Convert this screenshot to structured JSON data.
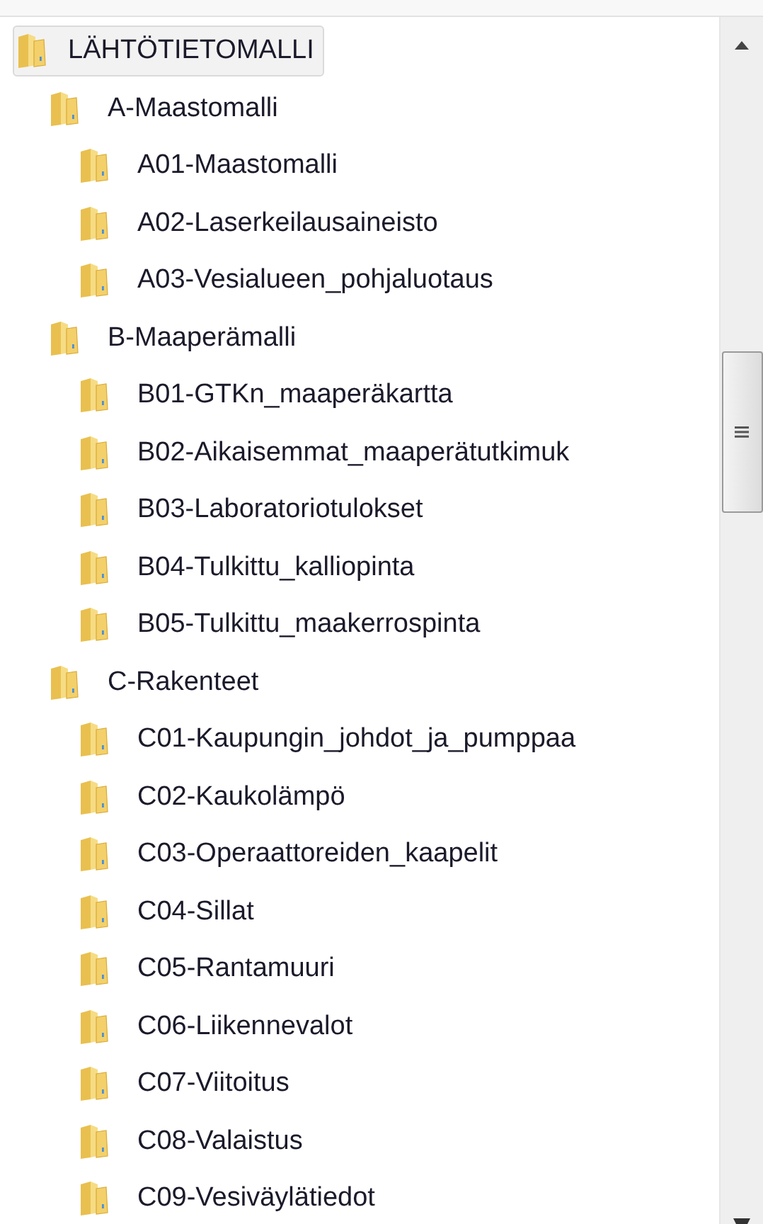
{
  "tree": [
    {
      "label": "LÄHTÖTIETOMALLI",
      "selected": true,
      "children": [
        {
          "label": "A-Maastomalli",
          "selected": false,
          "children": [
            {
              "label": "A01-Maastomalli",
              "selected": false
            },
            {
              "label": "A02-Laserkeilausaineisto",
              "selected": false
            },
            {
              "label": "A03-Vesialueen_pohjaluotaus",
              "selected": false
            }
          ]
        },
        {
          "label": "B-Maaperämalli",
          "selected": false,
          "children": [
            {
              "label": "B01-GTKn_maaperäkartta",
              "selected": false
            },
            {
              "label": "B02-Aikaisemmat_maaperätutkimuk",
              "selected": false
            },
            {
              "label": "B03-Laboratoriotulokset",
              "selected": false
            },
            {
              "label": "B04-Tulkittu_kalliopinta",
              "selected": false
            },
            {
              "label": "B05-Tulkittu_maakerrospinta",
              "selected": false
            }
          ]
        },
        {
          "label": "C-Rakenteet",
          "selected": false,
          "children": [
            {
              "label": "C01-Kaupungin_johdot_ja_pumppaa",
              "selected": false
            },
            {
              "label": "C02-Kaukolämpö",
              "selected": false
            },
            {
              "label": "C03-Operaattoreiden_kaapelit",
              "selected": false
            },
            {
              "label": "C04-Sillat",
              "selected": false
            },
            {
              "label": "C05-Rantamuuri",
              "selected": false
            },
            {
              "label": "C06-Liikennevalot",
              "selected": false
            },
            {
              "label": "C07-Viitoitus",
              "selected": false
            },
            {
              "label": "C08-Valaistus",
              "selected": false
            },
            {
              "label": "C09-Vesiväylätiedot",
              "selected": false
            }
          ]
        }
      ]
    }
  ]
}
